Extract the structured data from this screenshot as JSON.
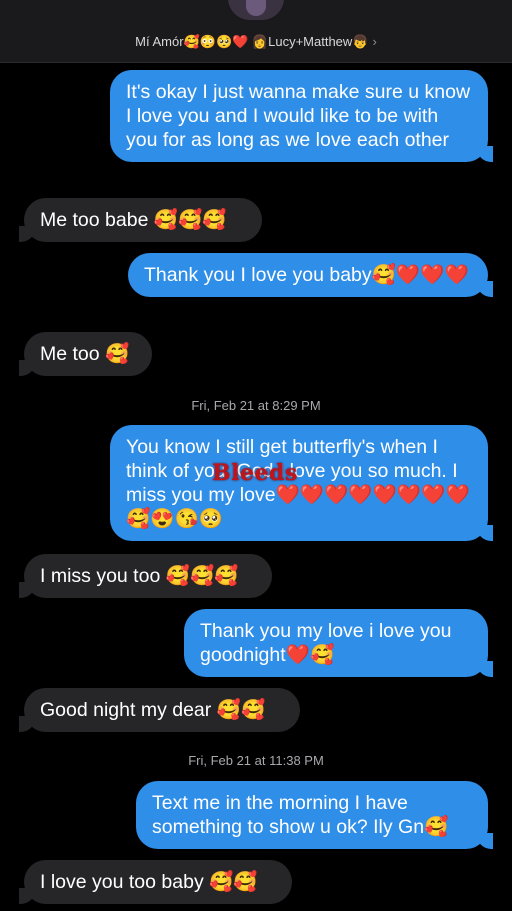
{
  "header": {
    "contact_name": "Mí Amór🥰😳🥺❤️ 👩Lucy+Matthew👦",
    "chevron": "›"
  },
  "messages": [
    {
      "text": "It's okay I just wanna make sure u know I love you and I would like to be with you for as long as we love each other",
      "from": "me"
    },
    {
      "text": "Me too babe 🥰🥰🥰",
      "from": "them"
    },
    {
      "text": "Thank you I love you baby🥰❤️❤️❤️",
      "from": "me"
    },
    {
      "text": "Me too 🥰",
      "from": "them"
    },
    {
      "text": "You know I still get butterfly's when I think of you. God I love you so much. I miss you my love❤️❤️❤️❤️❤️❤️❤️❤️🥰😍😘🥺",
      "from": "me"
    },
    {
      "text": "I miss you too 🥰🥰🥰",
      "from": "them"
    },
    {
      "text": "Thank you my love i love you goodnight❤️🥰",
      "from": "me"
    },
    {
      "text": "Good night my dear 🥰🥰",
      "from": "them"
    },
    {
      "text": "Text me in the morning I have something to show u ok? Ily Gn🥰",
      "from": "me"
    },
    {
      "text": "I love you too baby 🥰🥰",
      "from": "them"
    }
  ],
  "timestamps": [
    {
      "day": "Fri, Feb 21",
      "time": "8:29 PM"
    },
    {
      "day": "Fri, Feb 21",
      "time": "11:38 PM"
    }
  ],
  "watermark": "Bleeds",
  "colors": {
    "sent_bubble": "#2f8ee8",
    "received_bubble": "#262628",
    "background": "#000000"
  }
}
